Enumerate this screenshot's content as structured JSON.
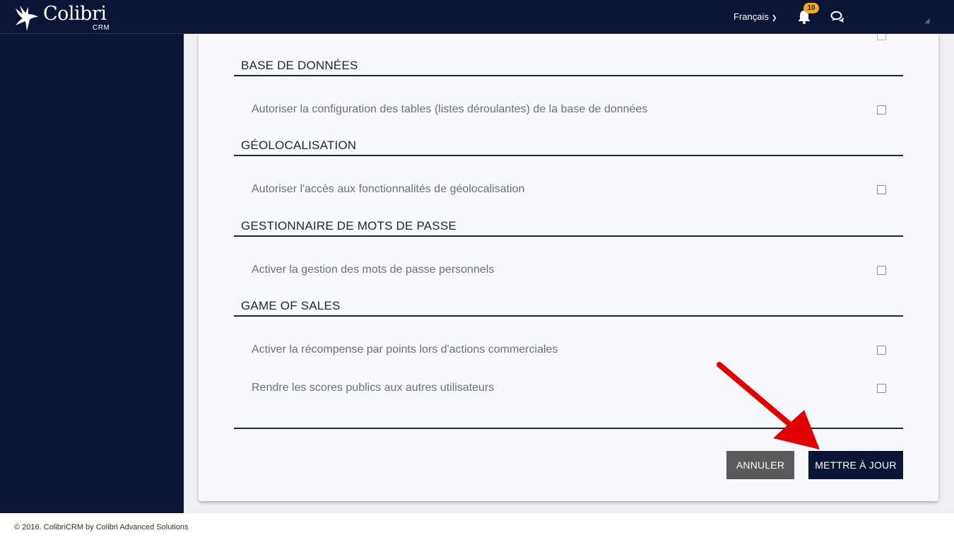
{
  "brand": {
    "name": "Colibri",
    "sub": "CRM"
  },
  "header": {
    "language": "Français",
    "notifications_count": "10"
  },
  "sections": [
    {
      "title": "BASE DE DONNÉES",
      "options": [
        {
          "label": "Autoriser la configuration des tables (listes déroulantes) de la base de données",
          "checked": false
        }
      ]
    },
    {
      "title": "GÉOLOCALISATION",
      "options": [
        {
          "label": "Autoriser l'accès aux fonctionnalités de géolocalisation",
          "checked": false
        }
      ]
    },
    {
      "title": "GESTIONNAIRE DE MOTS DE PASSE",
      "options": [
        {
          "label": "Activer la gestion des mots de passe personnels",
          "checked": false
        }
      ]
    },
    {
      "title": "GAME OF SALES",
      "options": [
        {
          "label": "Activer la récompense par points lors d'actions commerciales",
          "checked": false
        },
        {
          "label": "Rendre les scores publics aux autres utilisateurs",
          "checked": false
        }
      ]
    }
  ],
  "actions": {
    "cancel": "ANNULER",
    "update": "METTRE À JOUR"
  },
  "footer": {
    "text": "© 2016. ColibriCRM by Colibri Advanced Solutions"
  },
  "colors": {
    "navy": "#0d1536",
    "cancel_gray": "#58595b",
    "badge": "#f0a830",
    "arrow": "#e00000"
  }
}
